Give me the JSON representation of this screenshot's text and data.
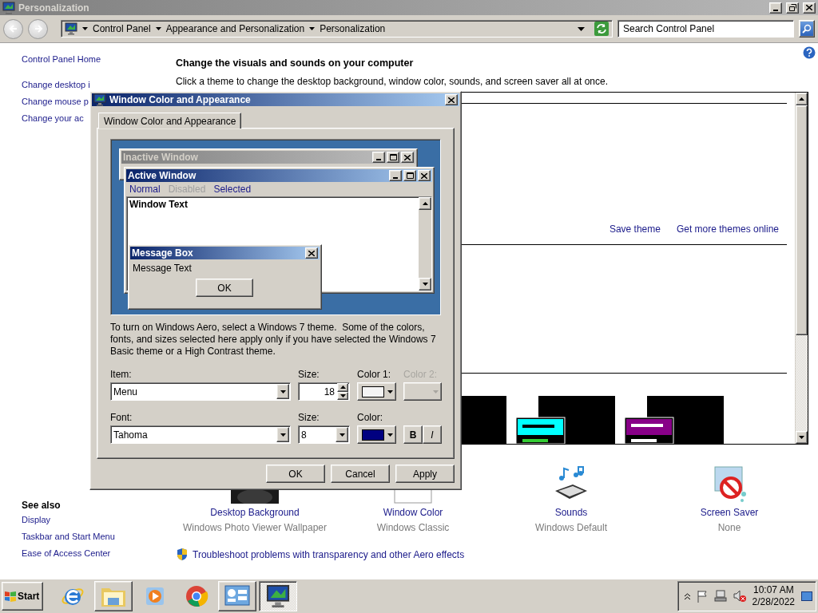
{
  "window": {
    "title": "Personalization"
  },
  "address_bar": {
    "breadcrumbs": [
      "Control Panel",
      "Appearance and Personalization",
      "Personalization"
    ]
  },
  "search": {
    "placeholder": "Search Control Panel"
  },
  "sidebar": {
    "links": [
      "Control Panel Home",
      "Change desktop i",
      "Change mouse p",
      "Change your ac"
    ],
    "see_also": {
      "title": "See also",
      "links": [
        "Display",
        "Taskbar and Start Menu",
        "Ease of Access Center"
      ]
    }
  },
  "main": {
    "heading": "Change the visuals and sounds on your computer",
    "description": "Click a theme to change the desktop background, window color, sounds, and screen saver all at once.",
    "theme_links": [
      "Save theme",
      "Get more themes online"
    ]
  },
  "settings": [
    {
      "kind": "background",
      "label": "Desktop Background",
      "value": "Windows Photo Viewer Wallpaper"
    },
    {
      "kind": "color",
      "label": "Window Color",
      "value": "Windows Classic"
    },
    {
      "kind": "sounds",
      "label": "Sounds",
      "value": "Windows Default"
    },
    {
      "kind": "screensaver",
      "label": "Screen Saver",
      "value": "None"
    }
  ],
  "troubleshoot": "Troubleshoot problems with transparency and other Aero effects",
  "dialog": {
    "title": "Window Color and Appearance",
    "tabs": [
      {
        "label": "Window Color and Appearance",
        "selected": true
      }
    ],
    "preview": {
      "inactive_title": "Inactive Window",
      "active_title": "Active Window",
      "menu": [
        {
          "label": "Normal",
          "disabled": false
        },
        {
          "label": "Disabled",
          "disabled": true
        },
        {
          "label": "Selected",
          "disabled": false
        }
      ],
      "window_text": "Window Text",
      "message_title": "Message Box",
      "message_text": "Message Text",
      "ok": "OK"
    },
    "note": "To turn on Windows Aero, select a Windows 7 theme.  Some of the colors, fonts, and sizes selected here apply only if you have selected the Windows 7 Basic theme or a High Contrast theme.",
    "rows": [
      {
        "label": "Item:",
        "value": "Menu",
        "size_label": "Size:",
        "size": {
          "kind": "spinner",
          "value": "18"
        },
        "colors": [
          {
            "label": "Color 1:",
            "color": "#f4f4f4",
            "disabled": false
          },
          {
            "label": "Color 2:",
            "disabled": true
          }
        ]
      },
      {
        "label": "Font:",
        "value": "Tahoma",
        "size_label": "Size:",
        "size": {
          "kind": "combo",
          "value": "8"
        },
        "colors": [
          {
            "label": "Color:",
            "color": "#000080",
            "disabled": false
          }
        ],
        "styles": [
          "B",
          "I"
        ]
      }
    ],
    "buttons": [
      "OK",
      "Cancel",
      "Apply"
    ]
  },
  "taskbar": {
    "start": "Start",
    "apps": [
      {
        "kind": "ie",
        "open": false,
        "selected": false
      },
      {
        "kind": "explorer",
        "open": true,
        "selected": false
      },
      {
        "kind": "media",
        "open": false,
        "selected": false
      },
      {
        "kind": "chrome",
        "open": false,
        "selected": false
      },
      {
        "kind": "controlpanel",
        "open": true,
        "selected": false
      },
      {
        "kind": "personalization",
        "open": true,
        "selected": true
      }
    ],
    "clock": {
      "time": "10:07 AM",
      "date": "2/28/2022"
    }
  }
}
